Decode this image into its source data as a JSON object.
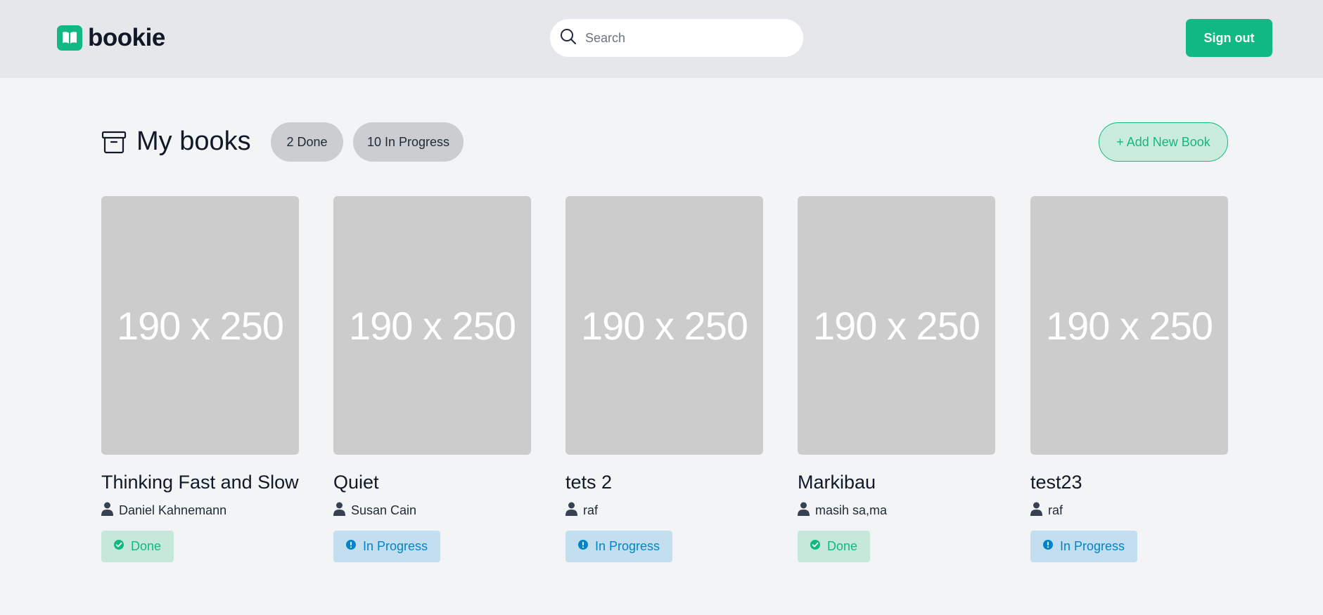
{
  "header": {
    "brand": "bookie",
    "search_placeholder": "Search",
    "signout_label": "Sign out"
  },
  "section": {
    "title": "My books",
    "filters": [
      {
        "label": "2 Done"
      },
      {
        "label": "10 In Progress"
      }
    ],
    "add_label": "+ Add New Book"
  },
  "books": [
    {
      "cover": "190 x 250",
      "title": "Thinking Fast and Slow",
      "author": "Daniel Kahnemann",
      "status": "Done"
    },
    {
      "cover": "190 x 250",
      "title": "Quiet",
      "author": "Susan Cain",
      "status": "In Progress"
    },
    {
      "cover": "190 x 250",
      "title": "tets 2",
      "author": "raf",
      "status": "In Progress"
    },
    {
      "cover": "190 x 250",
      "title": "Markibau",
      "author": "masih sa,ma",
      "status": "Done"
    },
    {
      "cover": "190 x 250",
      "title": "test23",
      "author": "raf",
      "status": "In Progress"
    }
  ],
  "colors": {
    "accent": "#10b981",
    "header_bg": "#e5e7eb",
    "page_bg": "#f3f4f6",
    "done_bg": "#c6e8db",
    "progress_bg": "#c3dfef",
    "progress_text": "#0284c7"
  },
  "icons": {
    "logo": "open-book-icon",
    "search": "search-icon",
    "section": "archive-box-icon",
    "author": "user-icon",
    "done": "check-circle-icon",
    "progress": "info-circle-icon"
  }
}
